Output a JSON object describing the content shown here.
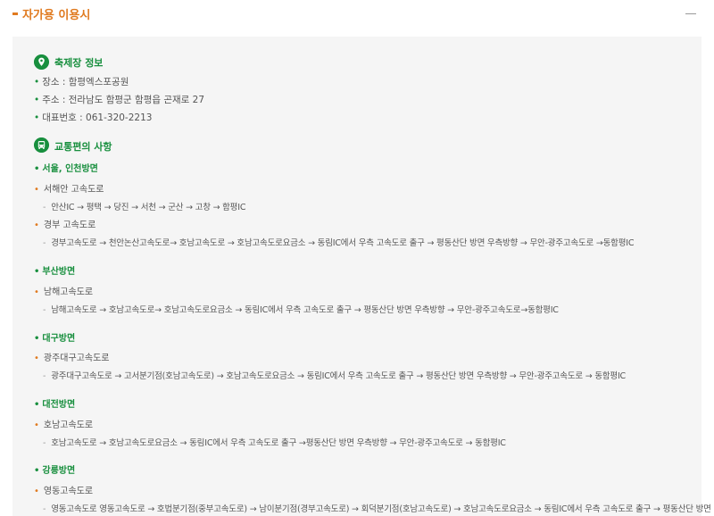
{
  "header": {
    "title": "자가용 이용시"
  },
  "festival": {
    "title": "축제장 정보",
    "items": [
      "장소 : 함평엑스포공원",
      "주소 : 전라남도 함평군 함평읍 곤재로 27",
      "대표번호 : 061-320-2213"
    ]
  },
  "transport": {
    "title": "교통편의 사항",
    "regions": [
      {
        "name": "서울, 인천방면",
        "roads": [
          {
            "name": "서해안 고속도로",
            "route": "안산IC → 평택 → 당진 → 서천 → 군산 → 고창 → 함평IC"
          },
          {
            "name": "경부 고속도로",
            "route": "경부고속도로 → 천안논산고속도로→ 호남고속도로 → 호남고속도로요금소 → 동림IC에서 우측 고속도로 출구 → 평동산단 방면 우측방향 → 무안-광주고속도로 →동함평IC"
          }
        ]
      },
      {
        "name": "부산방면",
        "roads": [
          {
            "name": "남해고속도로",
            "route": "남해고속도로 → 호남고속도로→ 호남고속도로요금소 → 동림IC에서 우측 고속도로 출구 → 평동산단 방면 우측방향 → 무안-광주고속도로→동함평IC"
          }
        ]
      },
      {
        "name": "대구방면",
        "roads": [
          {
            "name": "광주대구고속도로",
            "route": "광주대구고속도로 → 고서분기점(호남고속도로) → 호남고속도로요금소 → 동림IC에서 우측 고속도로 출구 → 평동산단 방면 우측방향 → 무안-광주고속도로 → 동함평IC"
          }
        ]
      },
      {
        "name": "대전방면",
        "roads": [
          {
            "name": "호남고속도로",
            "route": "호남고속도로 → 호남고속도로요금소 → 동림IC에서 우측 고속도로 출구 →평동산단 방면 우측방향 → 무안-광주고속도로 → 동함평IC"
          }
        ]
      },
      {
        "name": "강릉방면",
        "roads": [
          {
            "name": "영동고속도로",
            "route": "영동고속도로 영동고속도로 → 호법분기점(중부고속도로) → 남이분기점(경부고속도로) → 회덕분기점(호남고속도로) → 호남고속도로요금소 → 동림IC에서 우측 고속도로 출구 → 평동산단 방면"
          }
        ]
      }
    ]
  },
  "colors": {
    "accent_orange": "#e07a1f",
    "accent_green": "#188f3e",
    "panel_bg": "#f5f5f5"
  },
  "icons": {
    "festival": "location-pin-icon",
    "transport": "bus-icon",
    "collapse": "minus-icon"
  }
}
